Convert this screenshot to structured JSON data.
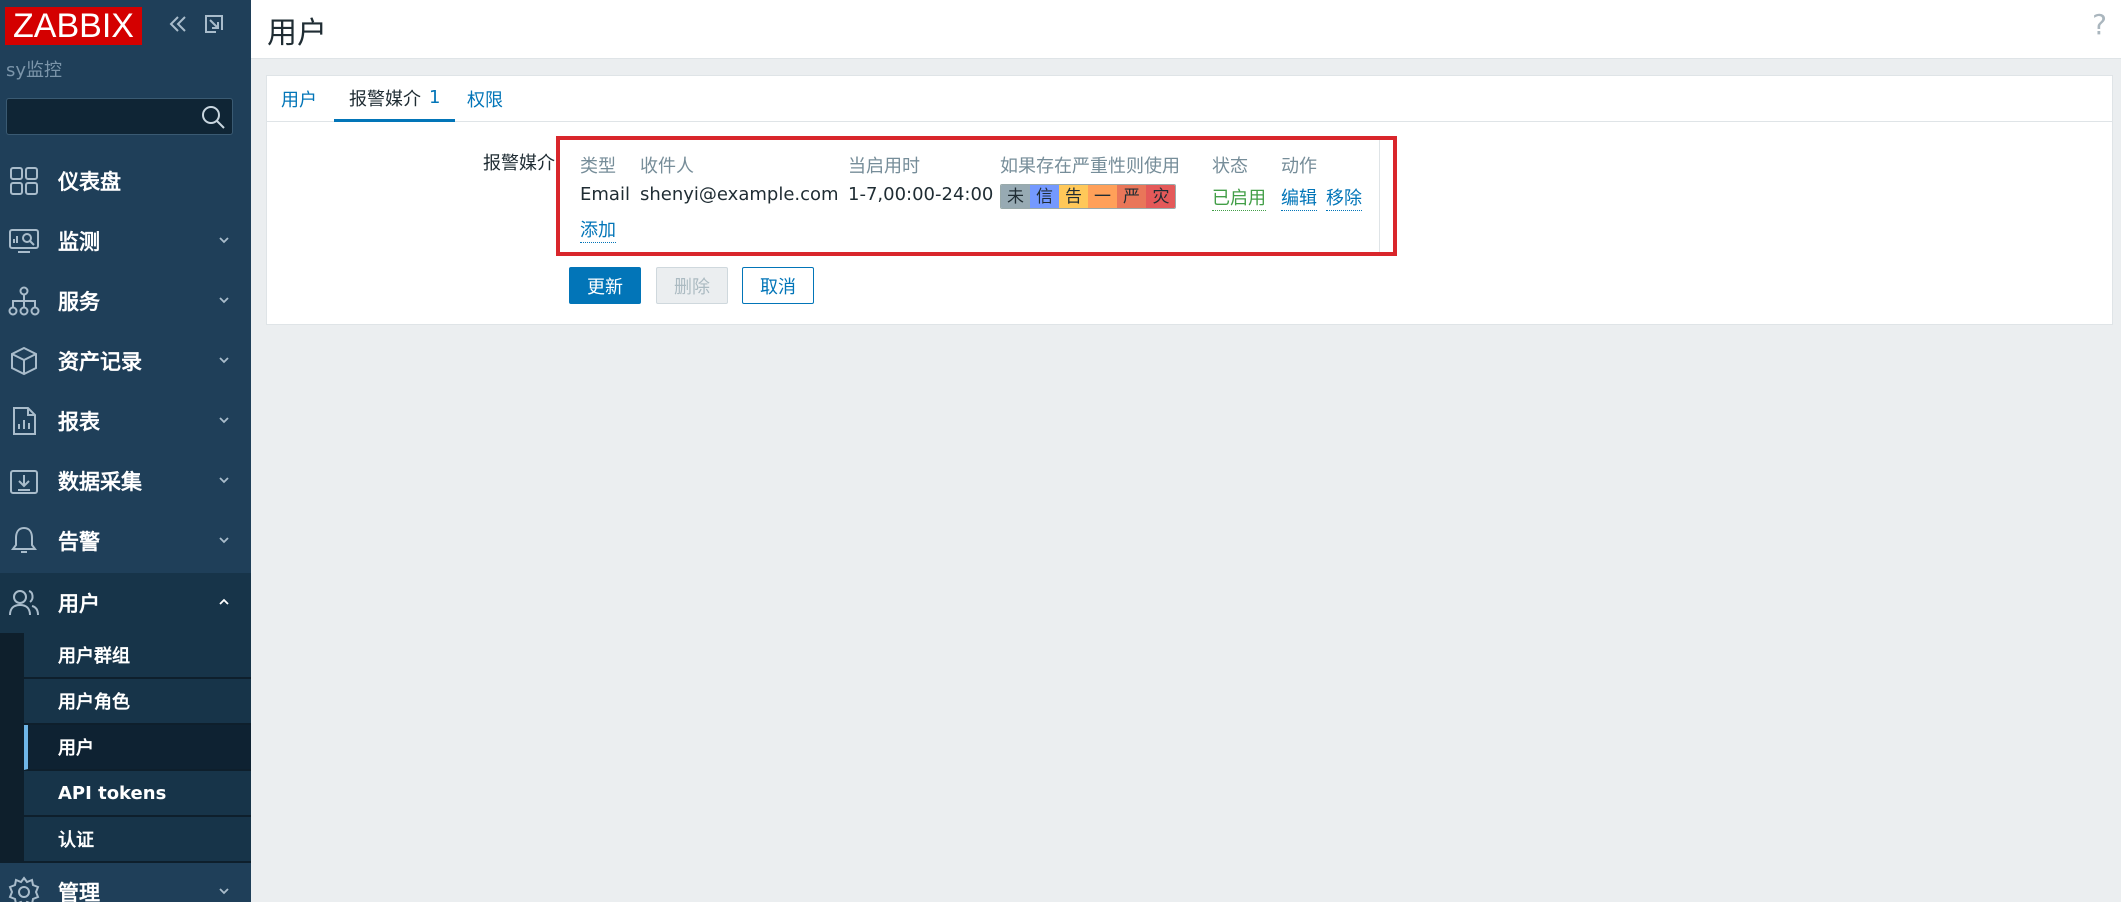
{
  "sidebar": {
    "logo": "ZABBIX",
    "server_name": "sy监控",
    "search": {
      "value": "",
      "placeholder": ""
    },
    "items": [
      {
        "label": "仪表盘",
        "icon": "dashboard-icon"
      },
      {
        "label": "监测",
        "icon": "monitoring-icon"
      },
      {
        "label": "服务",
        "icon": "services-icon"
      },
      {
        "label": "资产记录",
        "icon": "inventory-icon"
      },
      {
        "label": "报表",
        "icon": "reports-icon"
      },
      {
        "label": "数据采集",
        "icon": "data-collection-icon"
      },
      {
        "label": "告警",
        "icon": "alerts-icon"
      },
      {
        "label": "用户",
        "icon": "users-icon"
      },
      {
        "label": "管理",
        "icon": "administration-icon"
      }
    ],
    "submenu": [
      {
        "label": "用户群组"
      },
      {
        "label": "用户角色"
      },
      {
        "label": "用户"
      },
      {
        "label": "API tokens"
      },
      {
        "label": "认证"
      }
    ]
  },
  "header": {
    "title": "用户",
    "help": "?"
  },
  "tabs": [
    {
      "label": "用户"
    },
    {
      "label": "报警媒介",
      "count": "1"
    },
    {
      "label": "权限"
    }
  ],
  "media": {
    "field_label": "报警媒介",
    "columns": [
      "类型",
      "收件人",
      "当启用时",
      "如果存在严重性则使用",
      "状态",
      "动作"
    ],
    "row": {
      "type": "Email",
      "recipient": "shenyi@example.com",
      "when_active": "1-7,00:00-24:00",
      "severities": [
        {
          "label": "未",
          "color": "#97aab3"
        },
        {
          "label": "信",
          "color": "#7499ff"
        },
        {
          "label": "告",
          "color": "#ffc859"
        },
        {
          "label": "一",
          "color": "#ffa059"
        },
        {
          "label": "严",
          "color": "#e97659"
        },
        {
          "label": "灾",
          "color": "#e45959"
        }
      ],
      "status": "已启用",
      "edit": "编辑",
      "remove": "移除"
    },
    "add": "添加"
  },
  "buttons": {
    "update": "更新",
    "delete": "删除",
    "cancel": "取消"
  },
  "colors": {
    "sidebar": "#1f3f59",
    "accent": "#0275b8",
    "highlight_border": "#d9262b",
    "logo": "#d40000"
  }
}
